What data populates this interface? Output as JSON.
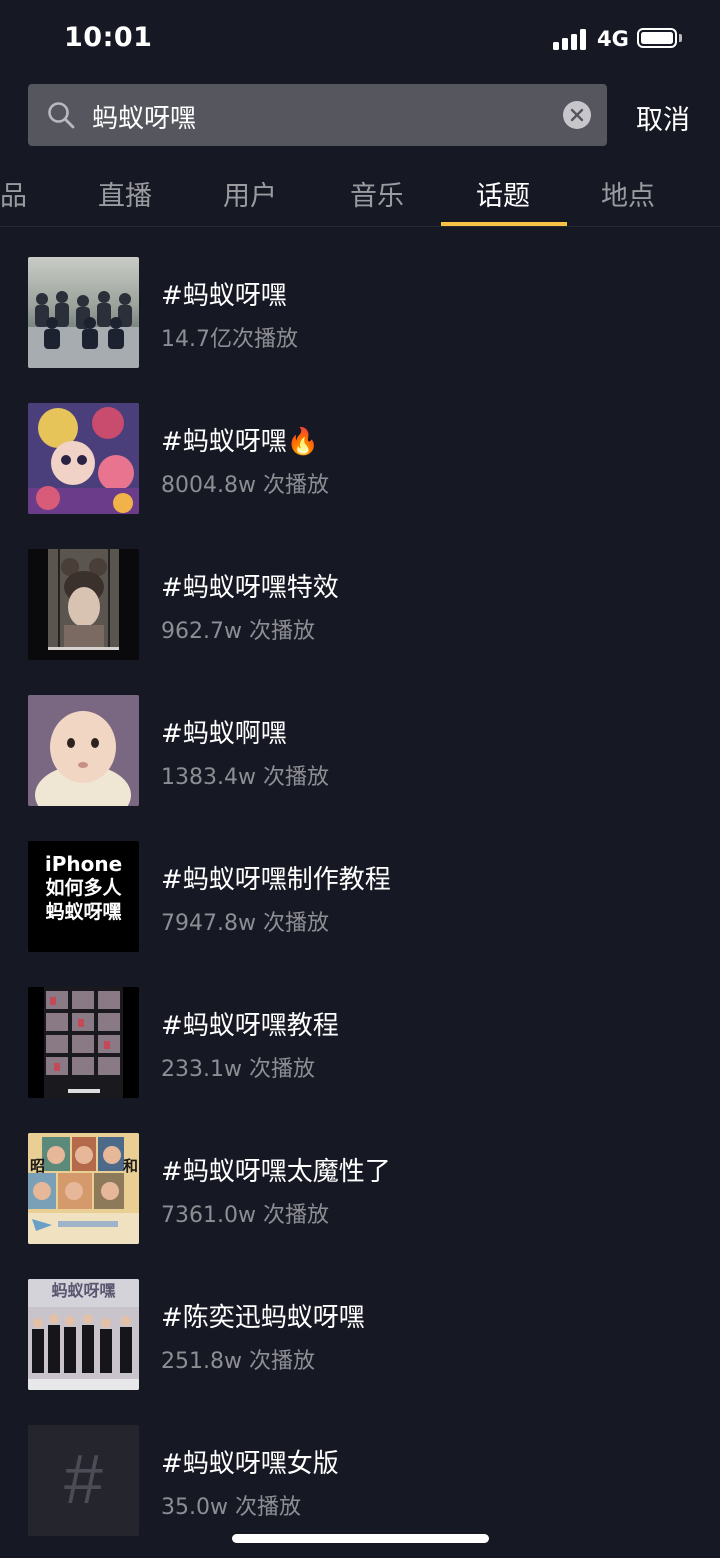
{
  "status_bar": {
    "time": "10:01",
    "network": "4G"
  },
  "search": {
    "query": "蚂蚁呀嘿",
    "cancel_label": "取消"
  },
  "tabs": [
    {
      "label": "品",
      "active": false
    },
    {
      "label": "直播",
      "active": false
    },
    {
      "label": "用户",
      "active": false
    },
    {
      "label": "音乐",
      "active": false
    },
    {
      "label": "话题",
      "active": true
    },
    {
      "label": "地点",
      "active": false
    }
  ],
  "accent_color": "#f6c344",
  "topics": [
    {
      "title": "#蚂蚁呀嘿",
      "plays": "14.7亿次播放",
      "thumb": "group-photo"
    },
    {
      "title": "#蚂蚁呀嘿",
      "badge": "🔥",
      "plays": "8004.8w 次播放",
      "thumb": "cartoon"
    },
    {
      "title": "#蚂蚁呀嘿特效",
      "plays": "962.7w 次播放",
      "thumb": "face-effect"
    },
    {
      "title": "#蚂蚁啊嘿",
      "plays": "1383.4w 次播放",
      "thumb": "baby"
    },
    {
      "title": "#蚂蚁呀嘿制作教程",
      "plays": "7947.8w 次播放",
      "thumb": "text-card",
      "thumb_text": [
        "iPhone",
        "如何多人",
        "蚂蚁呀嘿"
      ]
    },
    {
      "title": "#蚂蚁呀嘿教程",
      "plays": "233.1w 次播放",
      "thumb": "grid-screenshot"
    },
    {
      "title": "#蚂蚁呀嘿太魔性了",
      "plays": "7361.0w 次播放",
      "thumb": "faces-collage",
      "thumb_text": [
        "昭",
        "和"
      ]
    },
    {
      "title": "#陈奕迅蚂蚁呀嘿",
      "plays": "251.8w 次播放",
      "thumb": "stage-photo",
      "thumb_text": [
        "蚂蚁呀嘿"
      ]
    },
    {
      "title": "#蚂蚁呀嘿女版",
      "plays": "35.0w 次播放",
      "thumb": "hash-placeholder",
      "thumb_text": [
        "#"
      ]
    }
  ]
}
